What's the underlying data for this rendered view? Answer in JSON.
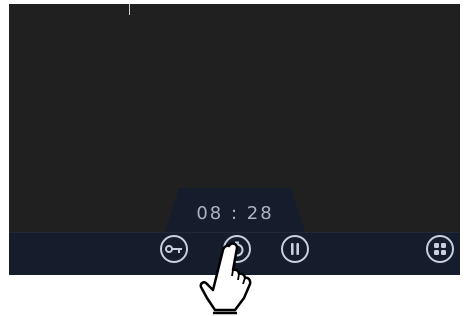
{
  "timer": {
    "value": "08 : 28"
  },
  "controls": {
    "key_icon": "key-icon",
    "timer_icon": "timer-icon",
    "pause_icon": "pause-icon",
    "menu_icon": "grid-menu-icon"
  },
  "pointer": {
    "icon": "hand-pointer-icon"
  },
  "colors": {
    "screen_bg": "#202020",
    "bar_bg": "#151c2b",
    "icon_color": "#c8d0de",
    "timer_text": "#a9b3c4"
  }
}
